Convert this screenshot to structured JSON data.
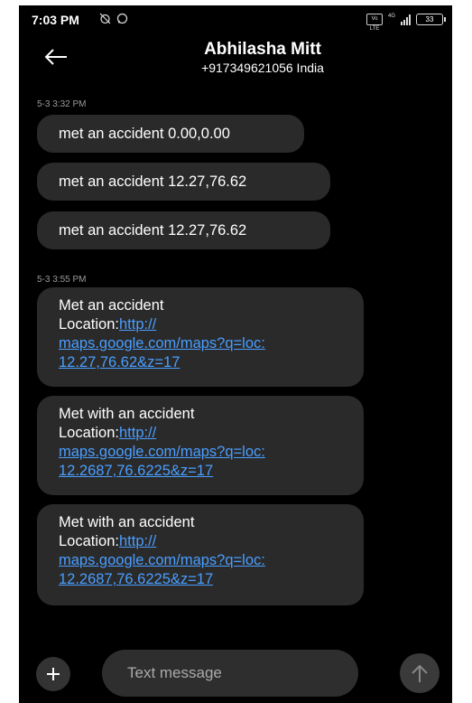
{
  "status_bar": {
    "time": "7:03 PM",
    "left_icons": [
      "alarm-off-icon",
      "whatsapp-icon"
    ],
    "volte_label": "Vo LTE",
    "network_label": "4G",
    "battery": "33"
  },
  "header": {
    "contact_name": "Abhilasha Mitt",
    "contact_number": "+917349621056 India"
  },
  "conversation": {
    "groups": [
      {
        "timestamp": "5-3 3:32 PM",
        "messages": [
          {
            "text": "met an accident 0.00,0.00"
          },
          {
            "text": "met an accident 12.27,76.62"
          },
          {
            "text": "met an accident 12.27,76.62"
          }
        ]
      },
      {
        "timestamp": "5-3 3:55 PM",
        "messages": [
          {
            "line1": "Met an accident",
            "location_label": "Location:",
            "link_part1": "http://",
            "link_part2": "maps.google.com/maps?q=loc:",
            "link_part3": "12.27,76.62&z=17"
          },
          {
            "line1": "Met with an accident",
            "location_label": "Location:",
            "link_part1": "http://",
            "link_part2": "maps.google.com/maps?q=loc:",
            "link_part3": "12.2687,76.6225&z=17"
          },
          {
            "line1": "Met with an accident",
            "location_label": "Location:",
            "link_part1": "http://",
            "link_part2": "maps.google.com/maps?q=loc:",
            "link_part3": "12.2687,76.6225&z=17"
          }
        ]
      }
    ]
  },
  "compose": {
    "placeholder": "Text message",
    "add_icon": "plus-icon",
    "send_icon": "arrow-up-icon"
  },
  "colors": {
    "background": "#000000",
    "bubble": "#2a2a2a",
    "link": "#4a9eff"
  }
}
